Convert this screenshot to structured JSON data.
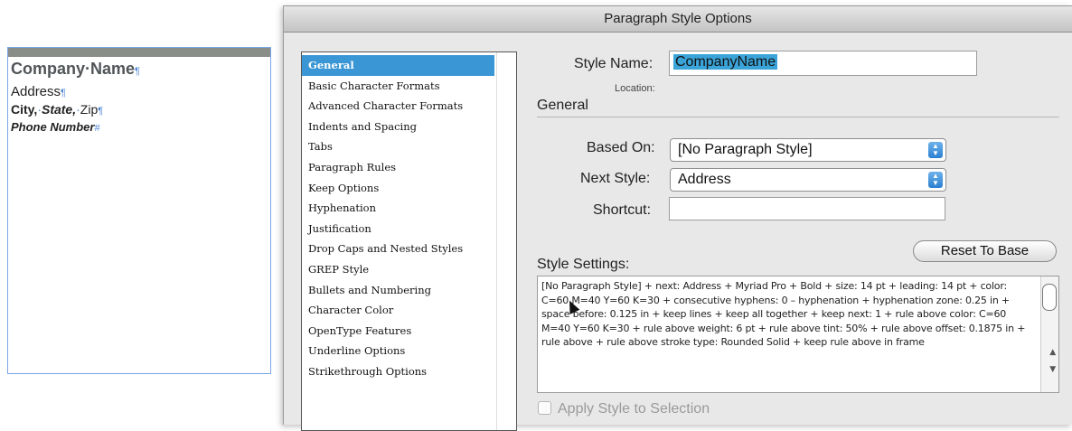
{
  "document": {
    "company_name": "Company·Name",
    "address": "Address",
    "city": "City,",
    "state": "State,",
    "zip": "Zip",
    "phone": "Phone Number",
    "pilcrow": "¶",
    "end_mark": "#"
  },
  "dialog": {
    "title": "Paragraph Style Options",
    "categories": [
      {
        "label": "General"
      },
      {
        "label": "Basic Character Formats"
      },
      {
        "label": "Advanced Character Formats"
      },
      {
        "label": "Indents and Spacing"
      },
      {
        "label": "Tabs"
      },
      {
        "label": "Paragraph Rules"
      },
      {
        "label": "Keep Options"
      },
      {
        "label": "Hyphenation"
      },
      {
        "label": "Justification"
      },
      {
        "label": "Drop Caps and Nested Styles"
      },
      {
        "label": "GREP Style"
      },
      {
        "label": "Bullets and Numbering"
      },
      {
        "label": "Character Color"
      },
      {
        "label": "OpenType Features"
      },
      {
        "label": "Underline Options"
      },
      {
        "label": "Strikethrough Options"
      }
    ],
    "selected_category": "General",
    "style_name_label": "Style Name:",
    "style_name_value": "CompanyName",
    "location_label": "Location:",
    "section_title": "General",
    "based_on_label": "Based On:",
    "based_on_value": "[No Paragraph Style]",
    "next_style_label": "Next Style:",
    "next_style_value": "Address",
    "shortcut_label": "Shortcut:",
    "shortcut_value": "",
    "reset_button": "Reset To Base",
    "style_settings_label": "Style Settings:",
    "style_settings_text": "[No Paragraph Style] + next: Address + Myriad Pro + Bold + size: 14 pt + leading: 14 pt + color: C=60 M=40 Y=60 K=30 + consecutive hyphens: 0 – hyphenation + hyphenation zone: 0.25 in + space before: 0.125 in + keep lines + keep all together + keep next: 1 + rule above color: C=60 M=40 Y=60 K=30 + rule above weight: 6 pt + rule above tint: 50% + rule above offset: 0.1875 in + rule above + rule above stroke type: Rounded Solid + keep rule above in frame",
    "apply_label": "Apply Style to Selection"
  },
  "colors": {
    "selection": "#3a96d4",
    "frame_border": "#7aa7e6"
  }
}
